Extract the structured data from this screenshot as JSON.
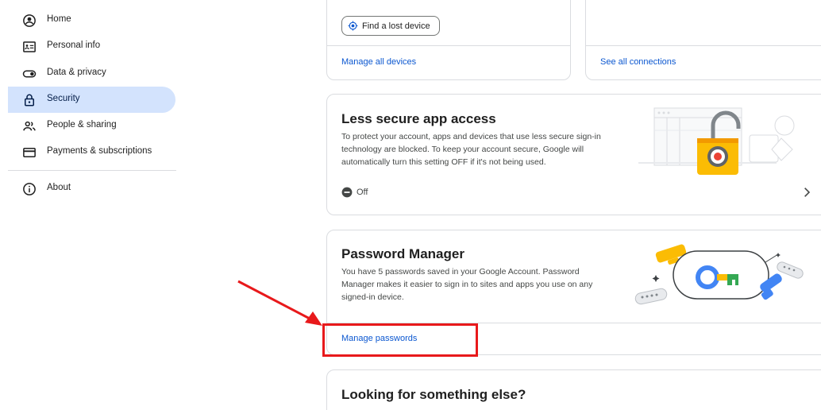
{
  "sidebar": {
    "items": [
      {
        "label": "Home",
        "icon": "account-circle-icon",
        "active": false
      },
      {
        "label": "Personal info",
        "icon": "id-card-icon",
        "active": false
      },
      {
        "label": "Data & privacy",
        "icon": "toggle-icon",
        "active": false
      },
      {
        "label": "Security",
        "icon": "lock-icon",
        "active": true
      },
      {
        "label": "People & sharing",
        "icon": "people-icon",
        "active": false
      },
      {
        "label": "Payments & subscriptions",
        "icon": "credit-card-icon",
        "active": false
      },
      {
        "label": "About",
        "icon": "info-icon",
        "active": false
      }
    ]
  },
  "devices_card": {
    "find_device_label": "Find a lost device",
    "manage_link": "Manage all devices"
  },
  "connections_card": {
    "see_link": "See all connections"
  },
  "less_secure_card": {
    "title": "Less secure app access",
    "description": "To protect your account, apps and devices that use less secure sign-in technology are blocked. To keep your account secure, Google will automatically turn this setting OFF if it's not being used.",
    "status": "Off"
  },
  "password_card": {
    "title": "Password Manager",
    "description": "You have 5 passwords saved in your Google Account. Password Manager makes it easier to sign in to sites and apps you use on any signed-in device.",
    "manage_link": "Manage passwords"
  },
  "else_card": {
    "title": "Looking for something else?"
  },
  "colors": {
    "accent": "#0b57d0",
    "active_nav": "#d3e3fd",
    "annotation": "#e8191b",
    "border": "#dadce0"
  }
}
